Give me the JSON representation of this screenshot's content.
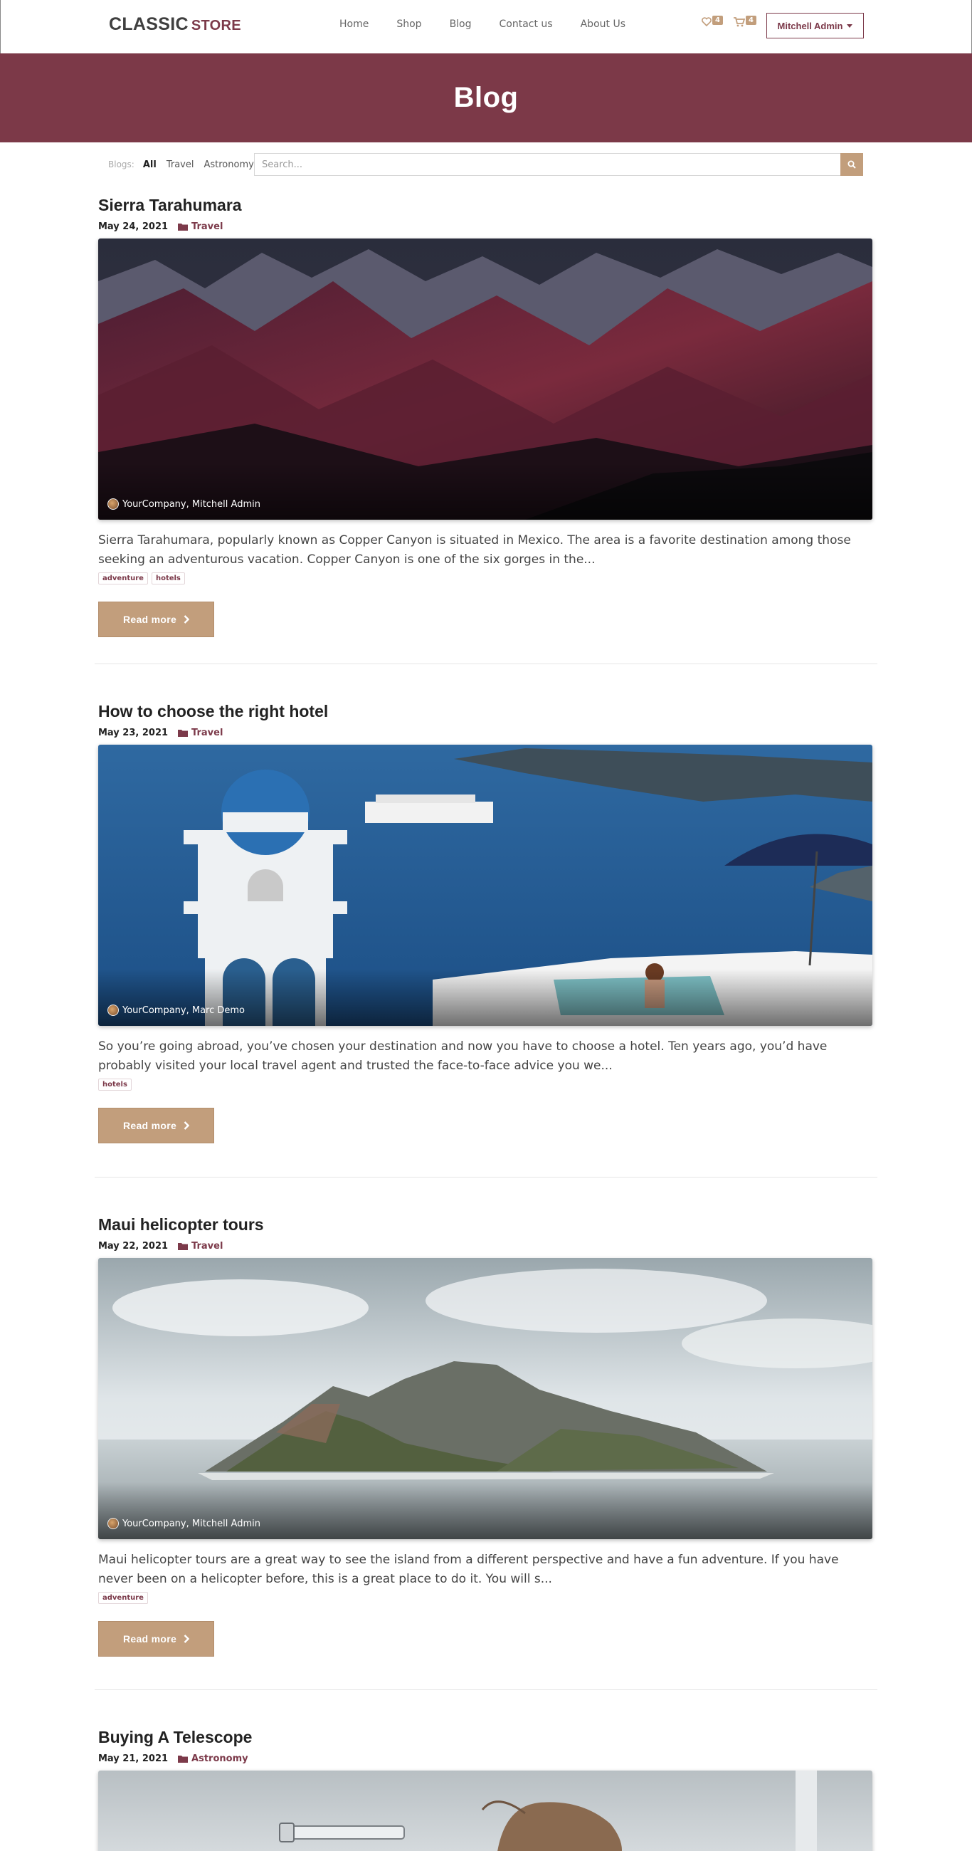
{
  "header": {
    "logo_main": "CLASSIC",
    "logo_sub": "STORE",
    "nav": [
      "Home",
      "Shop",
      "Blog",
      "Contact us",
      "About Us"
    ],
    "wishlist_count": "4",
    "cart_count": "4",
    "user": "Mitchell Admin"
  },
  "banner": {
    "title": "Blog"
  },
  "filters": {
    "label": "Blogs:",
    "options": [
      "All",
      "Travel",
      "Astronomy"
    ],
    "active": "All",
    "search_placeholder": "Search..."
  },
  "posts": [
    {
      "title": "Sierra Tarahumara",
      "date": "May 24, 2021",
      "category": "Travel",
      "author": "YourCompany, Mitchell Admin",
      "teaser": "Sierra Tarahumara, popularly known as Copper Canyon is situated in Mexico. The area is a favorite destination among those seeking an adventurous vacation. Copper Canyon is one of the six gorges in the...",
      "tags": [
        "adventure",
        "hotels"
      ],
      "read_more": "Read more"
    },
    {
      "title": "How to choose the right hotel",
      "date": "May 23, 2021",
      "category": "Travel",
      "author": "YourCompany, Marc Demo",
      "teaser": "So you’re going abroad, you’ve chosen your destination and now you have to choose a hotel. Ten years ago, you’d have probably visited your local travel agent and trusted the face-to-face advice you we...",
      "tags": [
        "hotels"
      ],
      "read_more": "Read more"
    },
    {
      "title": "Maui helicopter tours",
      "date": "May 22, 2021",
      "category": "Travel",
      "author": "YourCompany, Mitchell Admin",
      "teaser": "Maui helicopter tours are a great way to see the island from a different perspective and have a fun adventure. If you have never been on a helicopter before, this is a great place to do it. You will s...",
      "tags": [
        "adventure"
      ],
      "read_more": "Read more"
    },
    {
      "title": "Buying A Telescope",
      "date": "May 21, 2021",
      "category": "Astronomy"
    }
  ],
  "colors": {
    "brand": "#7c3948",
    "accent": "#c29e7c"
  },
  "icons": [
    "heart-icon",
    "cart-icon",
    "search-icon",
    "folder-icon",
    "chevron-right-icon"
  ]
}
